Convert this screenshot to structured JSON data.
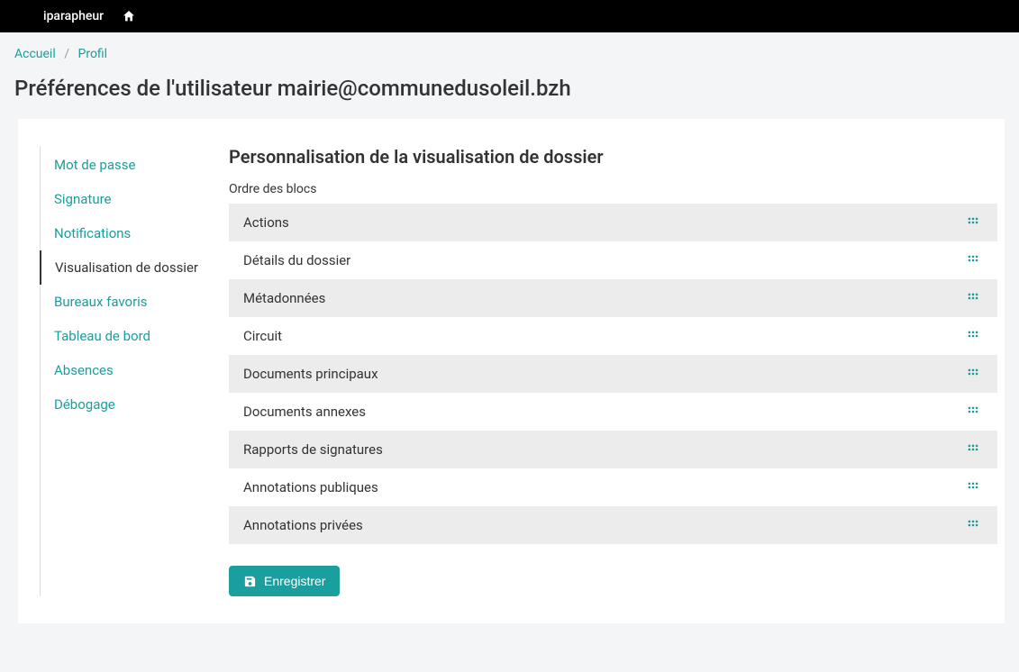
{
  "header": {
    "app_name": "iparapheur"
  },
  "breadcrumb": {
    "home": "Accueil",
    "current": "Profil"
  },
  "page": {
    "title": "Préférences de l'utilisateur mairie@communedusoleil.bzh"
  },
  "sidebar": {
    "items": [
      {
        "label": "Mot de passe",
        "active": false
      },
      {
        "label": "Signature",
        "active": false
      },
      {
        "label": "Notifications",
        "active": false
      },
      {
        "label": "Visualisation de dossier",
        "active": true
      },
      {
        "label": "Bureaux favoris",
        "active": false
      },
      {
        "label": "Tableau de bord",
        "active": false
      },
      {
        "label": "Absences",
        "active": false
      },
      {
        "label": "Débogage",
        "active": false
      }
    ]
  },
  "main": {
    "section_title": "Personnalisation de la visualisation de dossier",
    "subsection_label": "Ordre des blocs",
    "blocks": [
      {
        "label": "Actions"
      },
      {
        "label": "Détails du dossier"
      },
      {
        "label": "Métadonnées"
      },
      {
        "label": "Circuit"
      },
      {
        "label": "Documents principaux"
      },
      {
        "label": "Documents annexes"
      },
      {
        "label": "Rapports de signatures"
      },
      {
        "label": "Annotations publiques"
      },
      {
        "label": "Annotations privées"
      }
    ],
    "save_label": "Enregistrer"
  }
}
